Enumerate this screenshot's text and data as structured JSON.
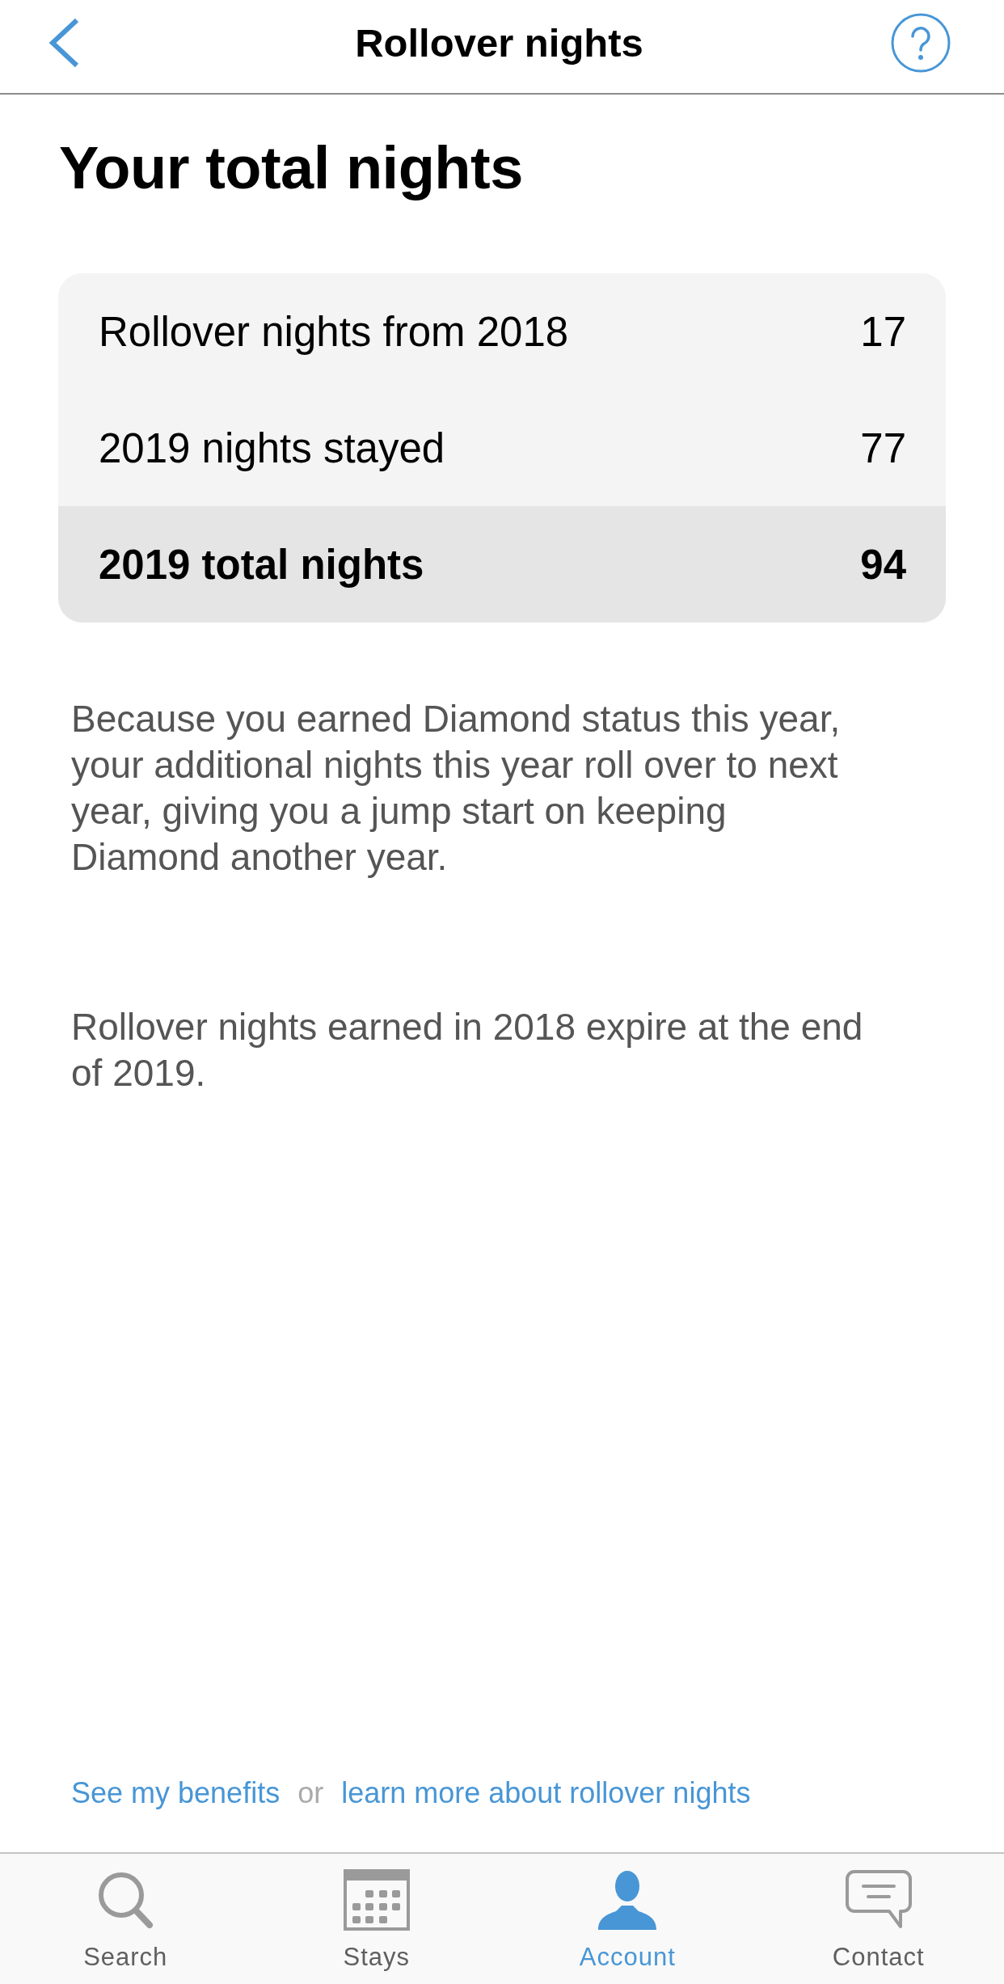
{
  "nav_bar": {
    "title": "Rollover nights"
  },
  "heading": "Your total nights",
  "summary": {
    "rows": [
      {
        "kind": "item",
        "label": "Rollover nights from 2018",
        "value": "17"
      },
      {
        "kind": "item",
        "label": "2019 nights stayed",
        "value": "77"
      },
      {
        "kind": "total",
        "label": "2019 total nights",
        "value": "94"
      }
    ]
  },
  "paragraphs": [
    "Because you earned Diamond status this year, your additional nights this year roll over to next year, giving you a jump start on keeping Diamond another year.",
    "Rollover nights earned in 2018 expire at the end of 2019."
  ],
  "footer_links": [
    {
      "kind": "link",
      "text": "See my benefits"
    },
    {
      "kind": "separator",
      "text": "or"
    },
    {
      "kind": "link",
      "text": "learn more about rollover nights"
    }
  ],
  "tab_bar": {
    "tabs": [
      {
        "label": "Search",
        "selected": false
      },
      {
        "label": "Stays",
        "selected": false
      },
      {
        "label": "Account",
        "selected": true
      },
      {
        "label": "Contact",
        "selected": false
      }
    ]
  }
}
